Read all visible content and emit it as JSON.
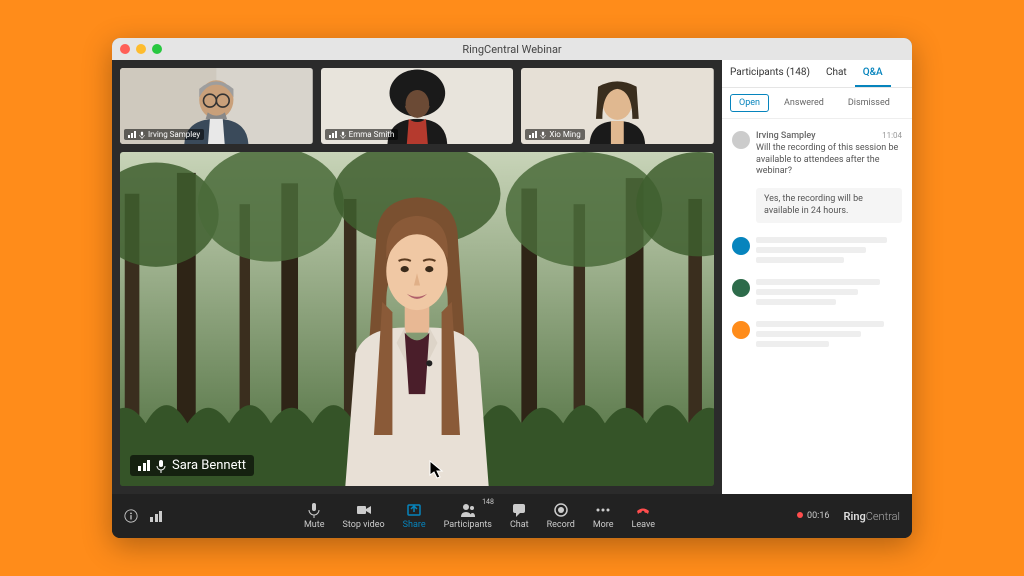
{
  "window": {
    "title": "RingCentral Webinar"
  },
  "thumbnails": [
    {
      "name": "Irving Sampley"
    },
    {
      "name": "Emma Smith"
    },
    {
      "name": "Xio Ming"
    }
  ],
  "main_speaker": {
    "name": "Sara Bennett"
  },
  "panel": {
    "tabs": {
      "participants": "Participants (148)",
      "chat": "Chat",
      "qa": "Q&A"
    },
    "subtabs": {
      "open": "Open",
      "answered": "Answered",
      "dismissed": "Dismissed"
    },
    "question": {
      "name": "Irving Sampley",
      "time": "11:04",
      "text": "Will the recording of this session be available to attendees after the webinar?",
      "answer": "Yes, the recording will be available in 24 hours."
    },
    "placeholder_colors": [
      "#0684bd",
      "#2d6b4a",
      "#ff8c1a"
    ]
  },
  "toolbar": {
    "mute": "Mute",
    "stop_video": "Stop video",
    "share": "Share",
    "participants": "Participants",
    "participants_count": "148",
    "chat": "Chat",
    "record": "Record",
    "more": "More",
    "leave": "Leave",
    "timer": "00:16",
    "brand_a": "Ring",
    "brand_b": "Central"
  }
}
